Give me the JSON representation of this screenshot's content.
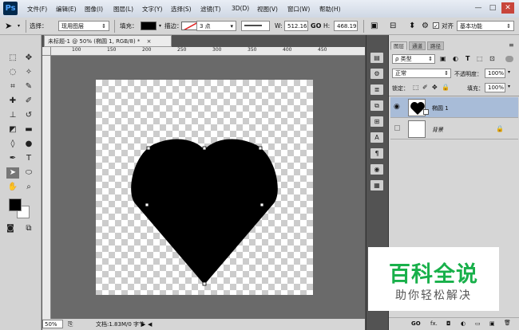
{
  "app": {
    "logo": "Ps"
  },
  "menu": [
    "文件(F)",
    "编辑(E)",
    "图像(I)",
    "图层(L)",
    "文字(Y)",
    "选择(S)",
    "滤镜(T)",
    "3D(D)",
    "视图(V)",
    "窗口(W)",
    "帮助(H)"
  ],
  "window_controls": {
    "min": "—",
    "max": "□",
    "close": "✕"
  },
  "options": {
    "select_label": "选择：",
    "select_value": "现用图层",
    "fill_label": "填充：",
    "stroke_label": "描边：",
    "stroke_width": "3 点",
    "w_label": "W:",
    "w_value": "512.16",
    "link": "GO",
    "h_label": "H:",
    "h_value": "468.19",
    "align_label": "对齐",
    "workspace": "基本功能"
  },
  "document": {
    "tab_title": "未标题-1 @ 50% (椭圆 1, RGB/8) *",
    "tab_close": "×",
    "ruler_ticks": [
      "100",
      "150",
      "200",
      "250",
      "300",
      "350",
      "400",
      "450"
    ],
    "zoom": "50%",
    "doc_info": "文档:1.83M/0 字节"
  },
  "panel": {
    "tabs": [
      "图层",
      "通道",
      "路径"
    ],
    "kind_label": "ρ 类型",
    "blend_mode": "正常",
    "opacity_label": "不透明度：",
    "opacity_value": "100%",
    "lock_label": "锁定：",
    "fill_label": "填充：",
    "fill_value": "100%",
    "layers": [
      {
        "name": "椭圆 1",
        "selected": true
      },
      {
        "name": "背景",
        "selected": false
      }
    ],
    "bottom_icons": [
      "GO",
      "fx.",
      "◘",
      "◐",
      "▭",
      "▣",
      "🗑"
    ]
  },
  "watermark": {
    "title": "百科全说",
    "subtitle": "助你轻松解决"
  },
  "colors": {
    "fg": "#000000",
    "bg": "#ffffff",
    "accent_watermark": "#18b04a",
    "selected_layer": "#a8bcd8"
  },
  "shape": {
    "name": "heart",
    "fill": "#000000"
  }
}
